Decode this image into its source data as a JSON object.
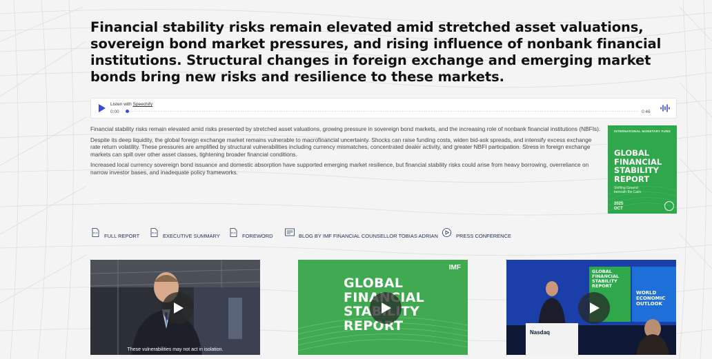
{
  "headline": "Financial stability risks remain elevated amid stretched asset valuations, sovereign bond market pressures, and rising influence of nonbank financial institutions. Structural changes in foreign exchange and emerging market bonds bring new risks and resilience to these markets.",
  "player": {
    "listen_prefix": "Listen with",
    "listen_brand": "Speechify",
    "time_current": "0:00",
    "time_total": "0:46"
  },
  "paragraphs": [
    "Financial stability risks remain elevated amid risks presented by stretched asset valuations, growing pressure in sovereign bond markets, and the increasing role of nonbank financial institutions (NBFIs).",
    "Despite its deep liquidity, the global foreign exchange market remains vulnerable to macrofinancial uncertainty. Shocks can raise funding costs, widen bid-ask spreads, and intensify excess exchange rate return volatility. These pressures are amplified by structural vulnerabilities including currency mismatches, concentrated dealer activity, and greater NBFI participation. Stress in foreign exchange markets can spill over other asset classes, tightening broader financial conditions.",
    "Increased local currency sovereign bond issuance and domestic absorption have supported emerging market resilience, but financial stability risks could arise from heavy borrowing, overreliance on narrow investor bases, and inadequate policy frameworks."
  ],
  "cover": {
    "publisher": "INTERNATIONAL MONETARY FUND",
    "title_lines": [
      "GLOBAL",
      "FINANCIAL",
      "STABILITY",
      "REPORT"
    ],
    "subtitle_lines": [
      "Shifting Ground",
      "beneath the Calm"
    ],
    "year": "2025",
    "month": "OCT",
    "color": "#2ea84a"
  },
  "links": [
    {
      "label": "FULL REPORT",
      "icon": "pdf-icon"
    },
    {
      "label": "EXECUTIVE SUMMARY",
      "icon": "pdf-icon"
    },
    {
      "label": "FOREWORD",
      "icon": "pdf-icon"
    },
    {
      "label": "BLOG BY IMF FINANCIAL COUNSELLOR TOBIAS ADRIAN",
      "icon": "blog-icon"
    },
    {
      "label": "PRESS CONFERENCE",
      "icon": "play-circle-icon"
    }
  ],
  "videos": [
    {
      "caption": "These vulnerabilities may not act in isolation."
    },
    {
      "brand": "IMF",
      "title_lines": [
        "GLOBAL",
        "FINANCIAL",
        "STABILITY",
        "REPORT"
      ]
    },
    {
      "exchange": "Nasdaq",
      "screen_left": [
        "GLOBAL",
        "FINANCIAL",
        "STABILITY",
        "REPORT"
      ],
      "screen_right": [
        "WORLD",
        "ECONOMIC",
        "OUTLOOK"
      ]
    }
  ],
  "colors": {
    "accent": "#3a4bd8",
    "link": "#1b2a5a",
    "green": "#2ea84a"
  }
}
